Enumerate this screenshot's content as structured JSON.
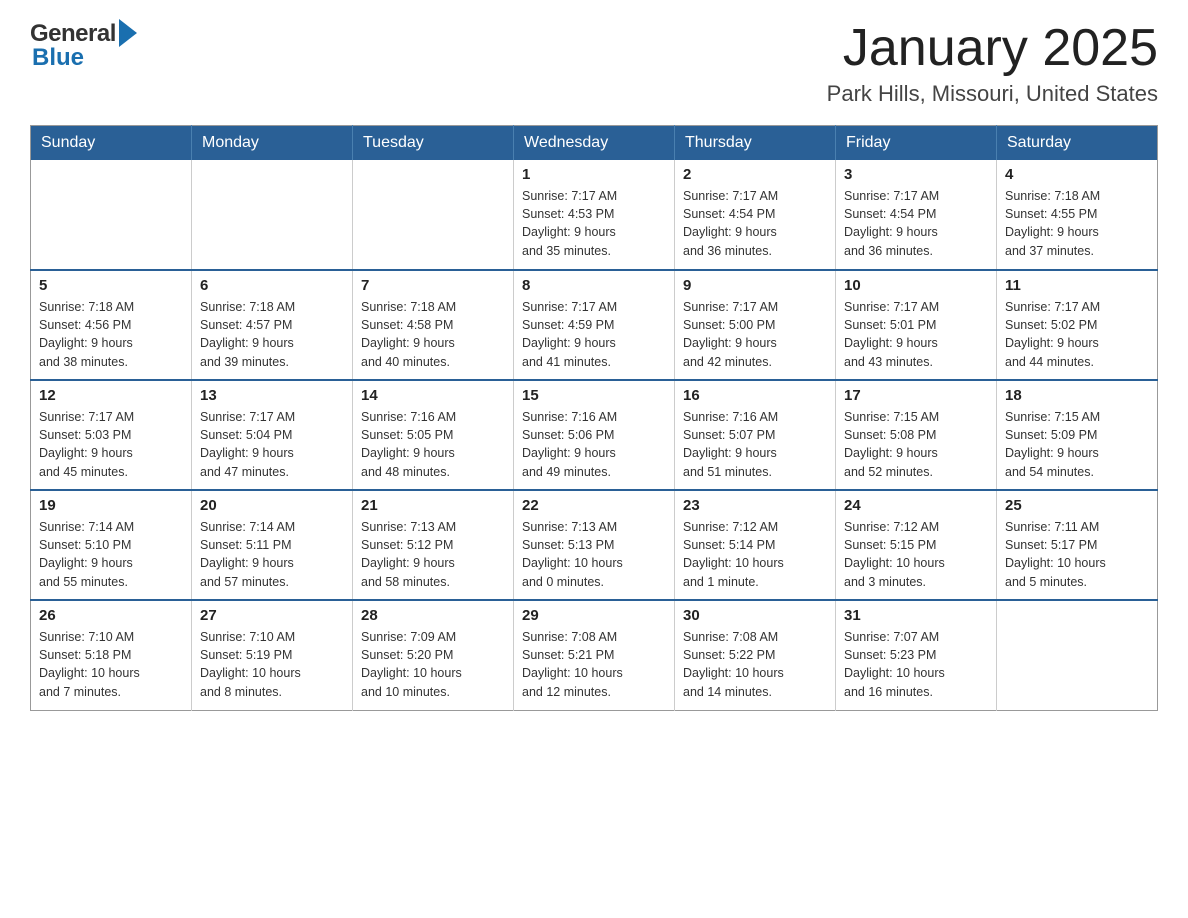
{
  "header": {
    "logo_general": "General",
    "logo_blue": "Blue",
    "month_title": "January 2025",
    "location": "Park Hills, Missouri, United States"
  },
  "calendar": {
    "weekdays": [
      "Sunday",
      "Monday",
      "Tuesday",
      "Wednesday",
      "Thursday",
      "Friday",
      "Saturday"
    ],
    "weeks": [
      [
        {
          "day": "",
          "info": ""
        },
        {
          "day": "",
          "info": ""
        },
        {
          "day": "",
          "info": ""
        },
        {
          "day": "1",
          "info": "Sunrise: 7:17 AM\nSunset: 4:53 PM\nDaylight: 9 hours\nand 35 minutes."
        },
        {
          "day": "2",
          "info": "Sunrise: 7:17 AM\nSunset: 4:54 PM\nDaylight: 9 hours\nand 36 minutes."
        },
        {
          "day": "3",
          "info": "Sunrise: 7:17 AM\nSunset: 4:54 PM\nDaylight: 9 hours\nand 36 minutes."
        },
        {
          "day": "4",
          "info": "Sunrise: 7:18 AM\nSunset: 4:55 PM\nDaylight: 9 hours\nand 37 minutes."
        }
      ],
      [
        {
          "day": "5",
          "info": "Sunrise: 7:18 AM\nSunset: 4:56 PM\nDaylight: 9 hours\nand 38 minutes."
        },
        {
          "day": "6",
          "info": "Sunrise: 7:18 AM\nSunset: 4:57 PM\nDaylight: 9 hours\nand 39 minutes."
        },
        {
          "day": "7",
          "info": "Sunrise: 7:18 AM\nSunset: 4:58 PM\nDaylight: 9 hours\nand 40 minutes."
        },
        {
          "day": "8",
          "info": "Sunrise: 7:17 AM\nSunset: 4:59 PM\nDaylight: 9 hours\nand 41 minutes."
        },
        {
          "day": "9",
          "info": "Sunrise: 7:17 AM\nSunset: 5:00 PM\nDaylight: 9 hours\nand 42 minutes."
        },
        {
          "day": "10",
          "info": "Sunrise: 7:17 AM\nSunset: 5:01 PM\nDaylight: 9 hours\nand 43 minutes."
        },
        {
          "day": "11",
          "info": "Sunrise: 7:17 AM\nSunset: 5:02 PM\nDaylight: 9 hours\nand 44 minutes."
        }
      ],
      [
        {
          "day": "12",
          "info": "Sunrise: 7:17 AM\nSunset: 5:03 PM\nDaylight: 9 hours\nand 45 minutes."
        },
        {
          "day": "13",
          "info": "Sunrise: 7:17 AM\nSunset: 5:04 PM\nDaylight: 9 hours\nand 47 minutes."
        },
        {
          "day": "14",
          "info": "Sunrise: 7:16 AM\nSunset: 5:05 PM\nDaylight: 9 hours\nand 48 minutes."
        },
        {
          "day": "15",
          "info": "Sunrise: 7:16 AM\nSunset: 5:06 PM\nDaylight: 9 hours\nand 49 minutes."
        },
        {
          "day": "16",
          "info": "Sunrise: 7:16 AM\nSunset: 5:07 PM\nDaylight: 9 hours\nand 51 minutes."
        },
        {
          "day": "17",
          "info": "Sunrise: 7:15 AM\nSunset: 5:08 PM\nDaylight: 9 hours\nand 52 minutes."
        },
        {
          "day": "18",
          "info": "Sunrise: 7:15 AM\nSunset: 5:09 PM\nDaylight: 9 hours\nand 54 minutes."
        }
      ],
      [
        {
          "day": "19",
          "info": "Sunrise: 7:14 AM\nSunset: 5:10 PM\nDaylight: 9 hours\nand 55 minutes."
        },
        {
          "day": "20",
          "info": "Sunrise: 7:14 AM\nSunset: 5:11 PM\nDaylight: 9 hours\nand 57 minutes."
        },
        {
          "day": "21",
          "info": "Sunrise: 7:13 AM\nSunset: 5:12 PM\nDaylight: 9 hours\nand 58 minutes."
        },
        {
          "day": "22",
          "info": "Sunrise: 7:13 AM\nSunset: 5:13 PM\nDaylight: 10 hours\nand 0 minutes."
        },
        {
          "day": "23",
          "info": "Sunrise: 7:12 AM\nSunset: 5:14 PM\nDaylight: 10 hours\nand 1 minute."
        },
        {
          "day": "24",
          "info": "Sunrise: 7:12 AM\nSunset: 5:15 PM\nDaylight: 10 hours\nand 3 minutes."
        },
        {
          "day": "25",
          "info": "Sunrise: 7:11 AM\nSunset: 5:17 PM\nDaylight: 10 hours\nand 5 minutes."
        }
      ],
      [
        {
          "day": "26",
          "info": "Sunrise: 7:10 AM\nSunset: 5:18 PM\nDaylight: 10 hours\nand 7 minutes."
        },
        {
          "day": "27",
          "info": "Sunrise: 7:10 AM\nSunset: 5:19 PM\nDaylight: 10 hours\nand 8 minutes."
        },
        {
          "day": "28",
          "info": "Sunrise: 7:09 AM\nSunset: 5:20 PM\nDaylight: 10 hours\nand 10 minutes."
        },
        {
          "day": "29",
          "info": "Sunrise: 7:08 AM\nSunset: 5:21 PM\nDaylight: 10 hours\nand 12 minutes."
        },
        {
          "day": "30",
          "info": "Sunrise: 7:08 AM\nSunset: 5:22 PM\nDaylight: 10 hours\nand 14 minutes."
        },
        {
          "day": "31",
          "info": "Sunrise: 7:07 AM\nSunset: 5:23 PM\nDaylight: 10 hours\nand 16 minutes."
        },
        {
          "day": "",
          "info": ""
        }
      ]
    ]
  }
}
